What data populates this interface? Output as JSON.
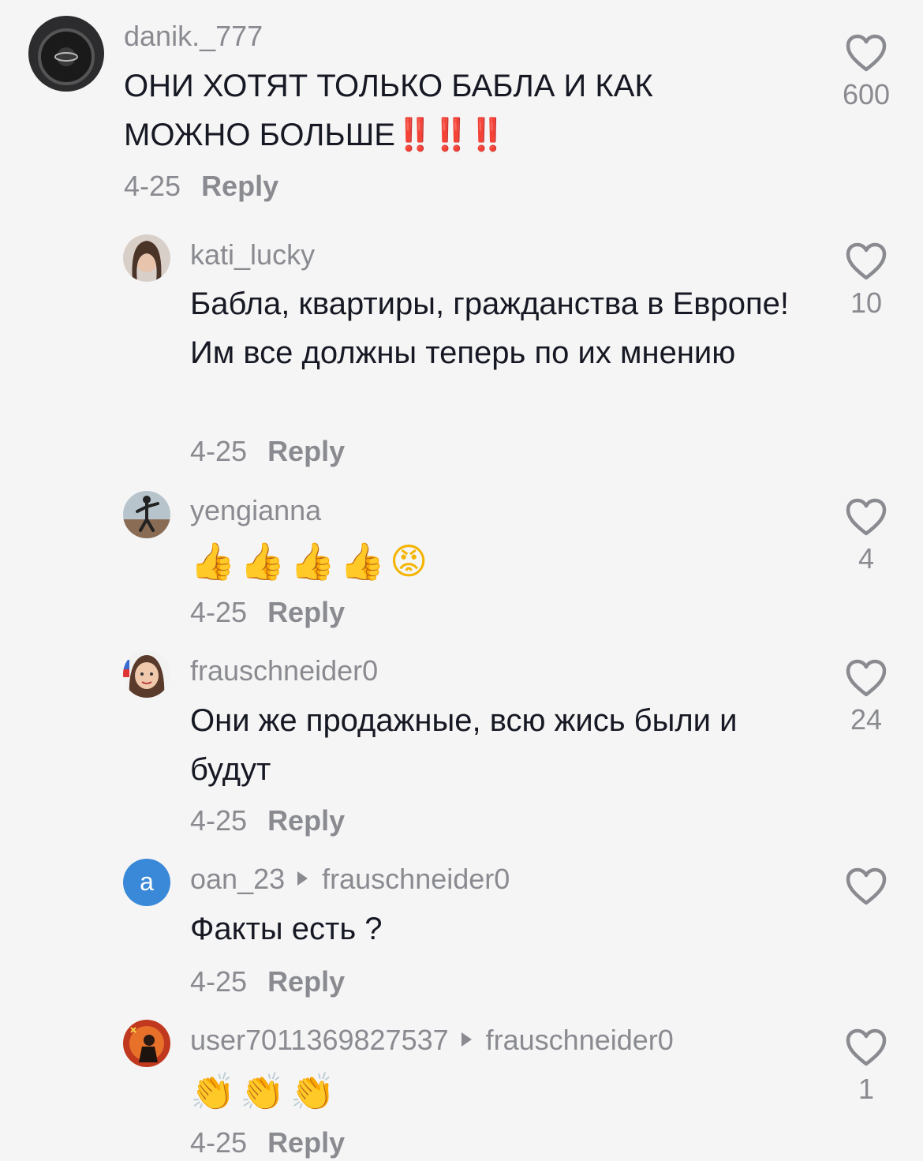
{
  "comments": [
    {
      "username": "danik._777",
      "text": "ОНИ ХОТЯТ ТОЛЬКО БАБЛА И КАК МОЖНО БОЛЬШЕ",
      "text_suffix": "‼️‼️‼️",
      "date": "4-25",
      "reply": "Reply",
      "likes": "600"
    },
    {
      "username": "kati_lucky",
      "text": "Бабла, квартиры, гражданства в Европе! Им все должны теперь по их мнению",
      "date": "4-25",
      "reply": "Reply",
      "likes": "10"
    },
    {
      "username": "yengianna",
      "text": "👍👍👍👍😡",
      "date": "4-25",
      "reply": "Reply",
      "likes": "4"
    },
    {
      "username": "frauschneider0",
      "text": "Они же продажные, всю жись были и будут",
      "date": "4-25",
      "reply": "Reply",
      "likes": "24"
    },
    {
      "username": "oan_23",
      "reply_to": "frauschneider0",
      "avatar_letter": "a",
      "text": "Факты есть ?",
      "date": "4-25",
      "reply": "Reply",
      "likes": ""
    },
    {
      "username": "user7011369827537",
      "reply_to": "frauschneider0",
      "text": "👏👏👏",
      "date": "4-25",
      "reply": "Reply",
      "likes": "1"
    }
  ],
  "colors": {
    "background": "#f5f5f5",
    "text": "#161823",
    "secondary": "#8a8b91",
    "avatar_blue": "#3a88d8",
    "bang_red": "#e22424"
  },
  "icons": [
    "heart-outline-icon",
    "reply-arrow-icon"
  ]
}
